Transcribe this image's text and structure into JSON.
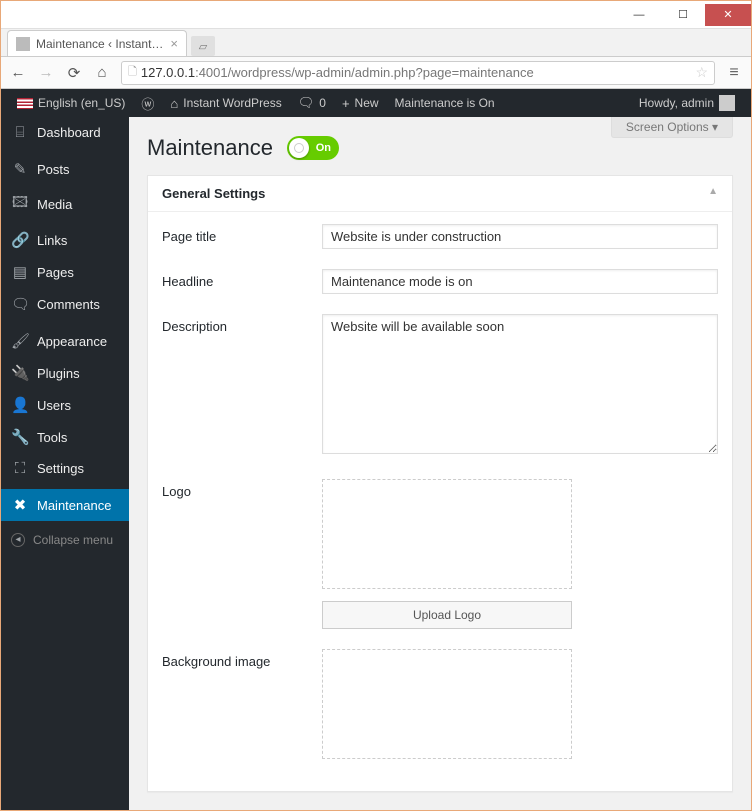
{
  "window": {
    "tab_title": "Maintenance ‹ Instant Wo…",
    "url_host": "127.0.0.1",
    "url_port": ":4001",
    "url_path": "/wordpress/wp-admin/admin.php?page=maintenance"
  },
  "adminbar": {
    "language": "English (en_US)",
    "site_name": "Instant WordPress",
    "comments_count": "0",
    "new_label": "New",
    "status": "Maintenance is On",
    "howdy": "Howdy, admin"
  },
  "sidebar": {
    "items": [
      {
        "label": "Dashboard",
        "icon": "⌸"
      },
      {
        "label": "Posts",
        "icon": "📌"
      },
      {
        "label": "Media",
        "icon": "🖾"
      },
      {
        "label": "Links",
        "icon": "🔗"
      },
      {
        "label": "Pages",
        "icon": "▤"
      },
      {
        "label": "Comments",
        "icon": "🗨"
      },
      {
        "label": "Appearance",
        "icon": "🖌"
      },
      {
        "label": "Plugins",
        "icon": "🔌"
      },
      {
        "label": "Users",
        "icon": "👤"
      },
      {
        "label": "Tools",
        "icon": "🔧"
      },
      {
        "label": "Settings",
        "icon": "⛶"
      },
      {
        "label": "Maintenance",
        "icon": "✖"
      }
    ],
    "collapse": "Collapse menu"
  },
  "content": {
    "screen_options": "Screen Options ▾",
    "heading": "Maintenance",
    "toggle_label": "On",
    "panel_title": "General Settings",
    "fields": {
      "page_title": {
        "label": "Page title",
        "value": "Website is under construction"
      },
      "headline": {
        "label": "Headline",
        "value": "Maintenance mode is on"
      },
      "description": {
        "label": "Description",
        "value": "Website will be available soon"
      },
      "logo": {
        "label": "Logo",
        "button": "Upload Logo"
      },
      "background": {
        "label": "Background image"
      }
    }
  }
}
